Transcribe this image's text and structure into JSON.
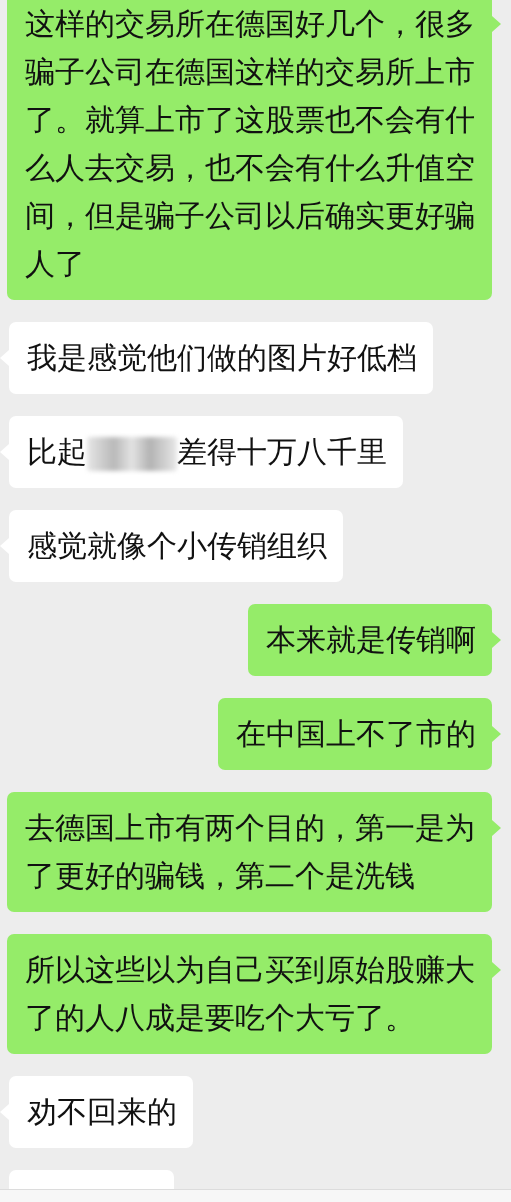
{
  "messages": [
    {
      "kind": "outgoing",
      "parts": [
        {
          "kind": "text",
          "text": "这样的交易所在德国好几个，很多骗子公司在德国这样的交易所上市了。就算上市了这股票也不会有什么人去交易，也不会有什么升值空间，但是骗子公司以后确实更好骗人了"
        }
      ]
    },
    {
      "kind": "incoming",
      "parts": [
        {
          "kind": "text",
          "text": "我是感觉他们做的图片好低档"
        }
      ]
    },
    {
      "kind": "incoming",
      "parts": [
        {
          "kind": "text",
          "text": "比起"
        },
        {
          "kind": "blur"
        },
        {
          "kind": "text",
          "text": "差得十万八千里"
        }
      ]
    },
    {
      "kind": "incoming",
      "parts": [
        {
          "kind": "text",
          "text": "感觉就像个小传销组织"
        }
      ]
    },
    {
      "kind": "outgoing",
      "parts": [
        {
          "kind": "text",
          "text": "本来就是传销啊"
        }
      ]
    },
    {
      "kind": "outgoing",
      "parts": [
        {
          "kind": "text",
          "text": "在中国上不了市的"
        }
      ]
    },
    {
      "kind": "outgoing",
      "parts": [
        {
          "kind": "text",
          "text": "去德国上市有两个目的，第一是为了更好的骗钱，第二个是洗钱"
        }
      ]
    },
    {
      "kind": "outgoing",
      "parts": [
        {
          "kind": "text",
          "text": "所以这些以为自己买到原始股赚大了的人八成是要吃个大亏了。"
        }
      ]
    },
    {
      "kind": "incoming",
      "parts": [
        {
          "kind": "text",
          "text": "劝不回来的"
        }
      ]
    },
    {
      "kind": "incoming"
    }
  ]
}
